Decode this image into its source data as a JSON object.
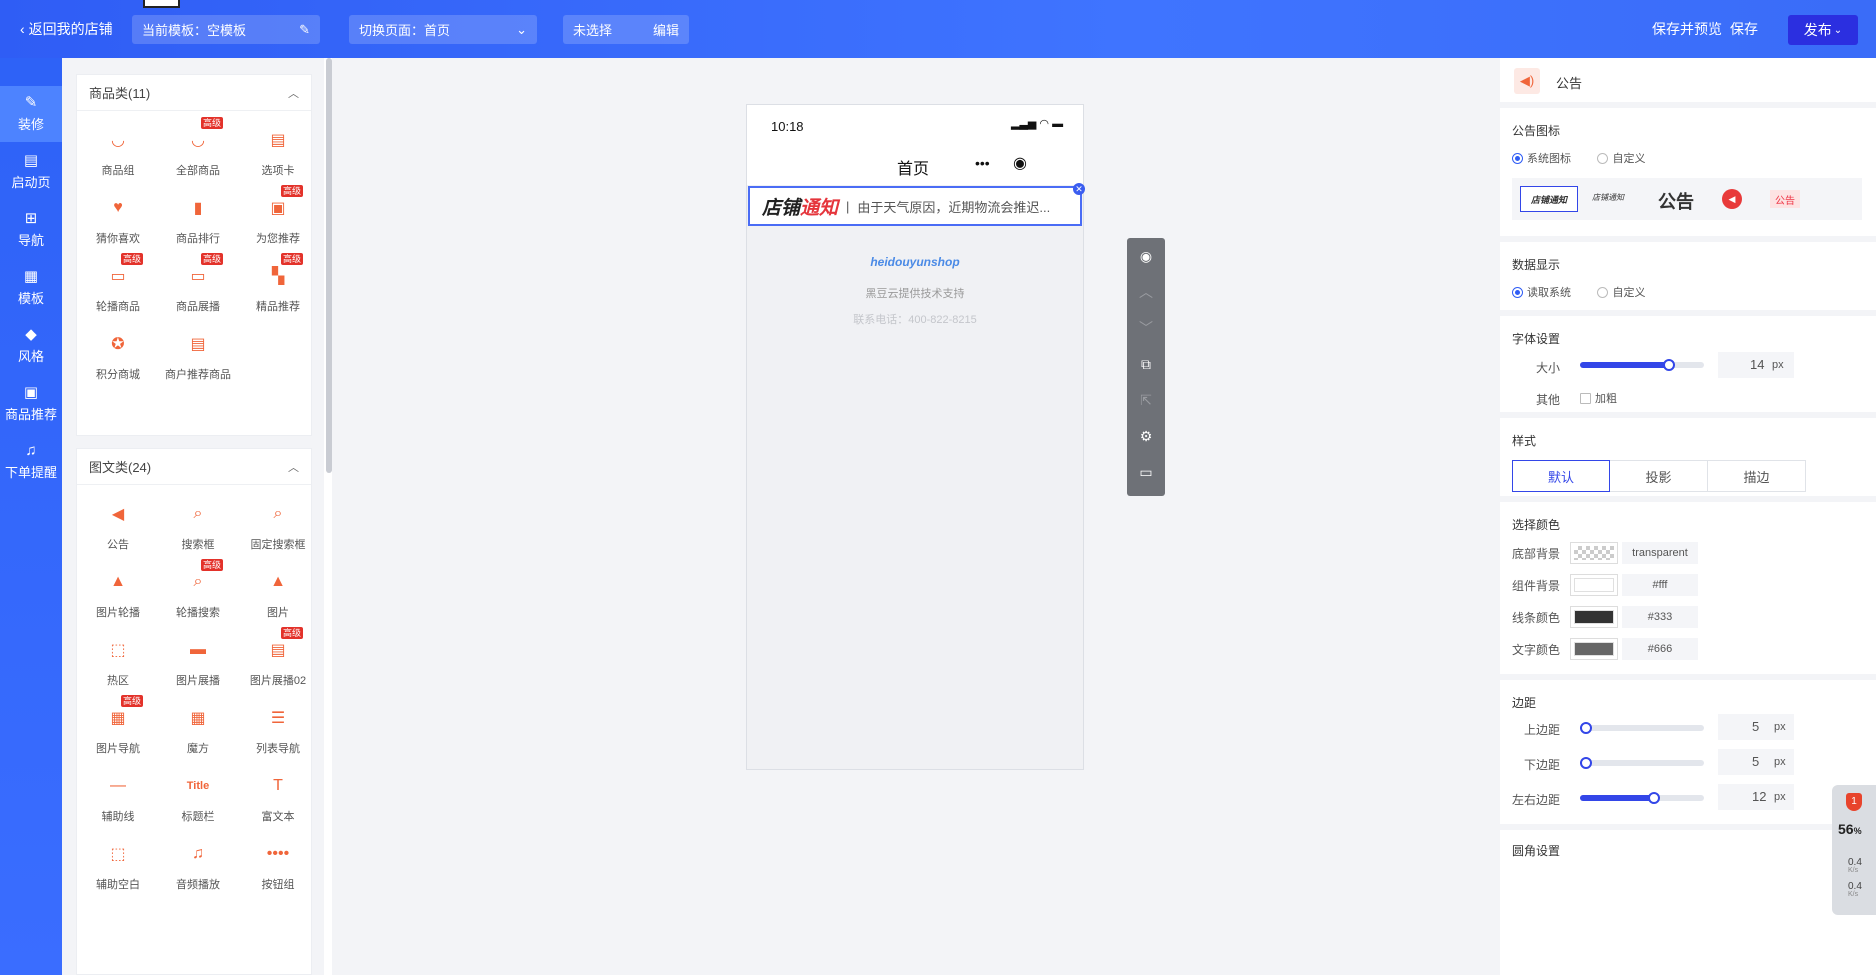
{
  "topbar": {
    "back": "返回我的店铺",
    "template_chip": "当前模板：空模板",
    "page_chip": "切换页面：首页",
    "selection_chip": "未选择",
    "edit": "编辑",
    "save_preview": "保存并预览",
    "save": "保存",
    "publish": "发布"
  },
  "rail": {
    "items": [
      {
        "label": "装修",
        "icon": "brush-icon"
      },
      {
        "label": "启动页",
        "icon": "launch-icon"
      },
      {
        "label": "导航",
        "icon": "grid-icon"
      },
      {
        "label": "模板",
        "icon": "template-icon"
      },
      {
        "label": "风格",
        "icon": "paint-icon"
      },
      {
        "label": "商品推荐",
        "icon": "recommend-icon"
      },
      {
        "label": "下单提醒",
        "icon": "bell-icon"
      }
    ]
  },
  "panel": {
    "cat1_title": "商品类(11)",
    "cat1_items": [
      {
        "label": "商品组",
        "badge": ""
      },
      {
        "label": "全部商品",
        "badge": "高级"
      },
      {
        "label": "选项卡",
        "badge": ""
      },
      {
        "label": "猜你喜欢",
        "badge": ""
      },
      {
        "label": "商品排行",
        "badge": ""
      },
      {
        "label": "为您推荐",
        "badge": "高级"
      },
      {
        "label": "轮播商品",
        "badge": "高级"
      },
      {
        "label": "商品展播",
        "badge": "高级"
      },
      {
        "label": "精品推荐",
        "badge": "高级"
      },
      {
        "label": "积分商城",
        "badge": ""
      },
      {
        "label": "商户推荐商品",
        "badge": ""
      }
    ],
    "cat2_title": "图文类(24)",
    "cat2_items": [
      {
        "label": "公告",
        "badge": ""
      },
      {
        "label": "搜索框",
        "badge": ""
      },
      {
        "label": "固定搜索框",
        "badge": ""
      },
      {
        "label": "图片轮播",
        "badge": ""
      },
      {
        "label": "轮播搜索",
        "badge": "高级"
      },
      {
        "label": "图片",
        "badge": ""
      },
      {
        "label": "热区",
        "badge": ""
      },
      {
        "label": "图片展播",
        "badge": ""
      },
      {
        "label": "图片展播02",
        "badge": "高级"
      },
      {
        "label": "图片导航",
        "badge": "高级"
      },
      {
        "label": "魔方",
        "badge": ""
      },
      {
        "label": "列表导航",
        "badge": ""
      },
      {
        "label": "辅助线",
        "badge": ""
      },
      {
        "label": "标题栏",
        "badge": ""
      },
      {
        "label": "富文本",
        "badge": ""
      },
      {
        "label": "辅助空白",
        "badge": ""
      },
      {
        "label": "音频播放",
        "badge": ""
      },
      {
        "label": "按钮组",
        "badge": ""
      }
    ],
    "title_icon_text": "Title"
  },
  "phone": {
    "time": "10:18",
    "title": "首页",
    "notice_logo_a": "店铺",
    "notice_logo_b": "通知",
    "notice_text": "由于天气原因，近期物流会推迟...",
    "brand": "heidouyunshop",
    "support": "黑豆云提供技术支持",
    "phone": "联系电话：400-822-8215"
  },
  "right": {
    "header_title": "公告",
    "icon_section": "公告图标",
    "opt_system_icon": "系统图标",
    "opt_custom": "自定义",
    "icon_samples": [
      "店铺通知",
      "店铺通知",
      "公告",
      "公告"
    ],
    "data_section": "数据显示",
    "opt_read_system": "读取系统",
    "opt_custom2": "自定义",
    "font_section": "字体设置",
    "size_label": "大小",
    "size_value": "14",
    "size_fraction": 0.72,
    "px": "px",
    "other_label": "其他",
    "bold_label": "加粗",
    "style_section": "样式",
    "styles": [
      "默认",
      "投影",
      "描边"
    ],
    "color_section": "选择颜色",
    "colors": [
      {
        "label": "底部背景",
        "value": "transparent",
        "swatch": "transparent"
      },
      {
        "label": "组件背景",
        "value": "#fff",
        "swatch": "#ffffff"
      },
      {
        "label": "线条颜色",
        "value": "#333",
        "swatch": "#333333"
      },
      {
        "label": "文字颜色",
        "value": "#666",
        "swatch": "#666666"
      }
    ],
    "margin_section": "边距",
    "margins": [
      {
        "label": "上边距",
        "value": "5",
        "fraction": 0.05
      },
      {
        "label": "下边距",
        "value": "5",
        "fraction": 0.05
      },
      {
        "label": "左右边距",
        "value": "12",
        "fraction": 0.6
      }
    ],
    "rounded_section": "圆角设置"
  },
  "float_widget": {
    "badge": "1",
    "percent": "56",
    "percent_unit": "%",
    "up": "0.4",
    "down": "0.4",
    "unit": "K/s"
  },
  "colors": {
    "accent": "#2f5df5",
    "slider": "#3346e8",
    "orange": "#f0653a",
    "badge_red": "#e3322a"
  }
}
